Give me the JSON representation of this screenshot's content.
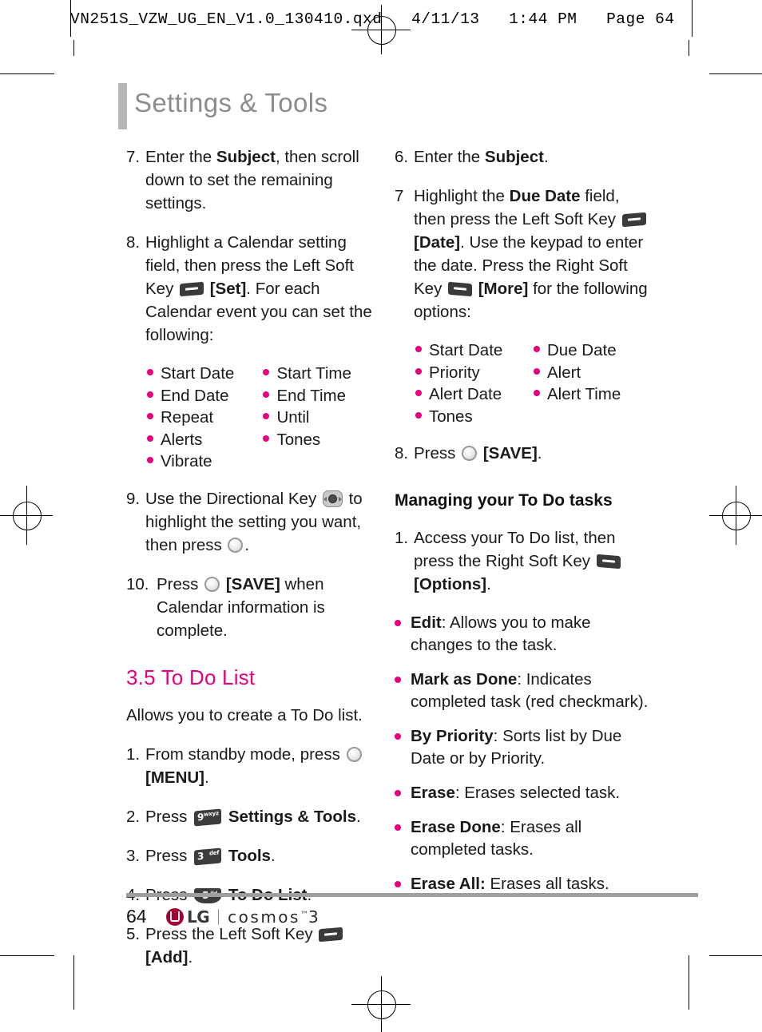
{
  "print_header": {
    "text": "VN251S_VZW_UG_EN_V1.0_130410.qxd   4/11/13   1:44 PM   Page 64"
  },
  "page_title": "Settings & Tools",
  "colors": {
    "accent_magenta": "#e6007e",
    "title_gray": "#8d8d8d",
    "rule_gray": "#9e9e9e",
    "lg_crimson": "#a50034"
  },
  "left_column": {
    "step7": {
      "num": "7.",
      "body_a": "Enter the ",
      "bold_a": "Subject",
      "body_b": ", then scroll down to set the remaining settings."
    },
    "step8": {
      "num": "8.",
      "body_a": "Highlight a Calendar setting field, then press the Left Soft Key ",
      "bold_a": "[Set]",
      "body_b": ". For each Calendar event you can set the following:"
    },
    "calendar_options": {
      "col1": [
        "Start Date",
        "End Date",
        "Repeat",
        "Alerts",
        "Vibrate"
      ],
      "col2": [
        "Start Time",
        "End Time",
        "Until",
        "Tones"
      ]
    },
    "step9": {
      "num": "9.",
      "body_a": "Use the Directional Key ",
      "body_b": " to highlight the setting you want, then press ",
      "body_c": "."
    },
    "step10": {
      "num": "10.",
      "body_a": "Press ",
      "bold_a": "[SAVE]",
      "body_b": " when Calendar information is complete."
    },
    "section_heading": "3.5 To Do List",
    "intro": "Allows you to create a To Do list.",
    "step1": {
      "num": "1.",
      "body_a": "From standby mode, press ",
      "bold_a": "[MENU]",
      "body_b": "."
    },
    "step2": {
      "num": "2.",
      "body_a": "Press ",
      "key": {
        "digit": "9",
        "letters": "wxyz"
      },
      "bold_a": "Settings & Tools",
      "body_b": "."
    },
    "step3": {
      "num": "3.",
      "body_a": "Press ",
      "key": {
        "digit": "3",
        "letters": "def"
      },
      "bold_a": "Tools",
      "body_b": "."
    },
    "step4": {
      "num": "4.",
      "body_a": "Press ",
      "key": {
        "digit": "5",
        "letters": "jkl"
      },
      "bold_a": "To Do List",
      "body_b": "."
    },
    "step5": {
      "num": "5.",
      "body_a": "Press the Left Soft Key ",
      "bold_a": "[Add]",
      "body_b": "."
    }
  },
  "right_column": {
    "step6": {
      "num": "6.",
      "body_a": "Enter the ",
      "bold_a": "Subject",
      "body_b": "."
    },
    "step7": {
      "num": "7",
      "body_a": "Highlight the ",
      "bold_a": "Due Date",
      "body_b": " field, then press the Left Soft Key ",
      "bold_b": "[Date]",
      "body_c": ". Use the keypad to enter the date. Press the Right Soft Key ",
      "bold_c": "[More]",
      "body_d": " for the following options:"
    },
    "todo_options": {
      "col1": [
        "Start Date",
        "Priority",
        "Alert Date",
        "Tones"
      ],
      "col2": [
        "Due Date",
        "Alert",
        "Alert Time"
      ]
    },
    "step8": {
      "num": "8.",
      "body_a": "Press ",
      "bold_a": "[SAVE]",
      "body_b": "."
    },
    "sub_heading": "Managing your To Do tasks",
    "step1": {
      "num": "1.",
      "body_a": "Access your To Do list, then press the Right Soft Key ",
      "bold_a": "[Options]",
      "body_b": "."
    },
    "options": [
      {
        "term": "Edit",
        "desc": ": Allows you to make changes to the task."
      },
      {
        "term": "Mark as Done",
        "desc": ": Indicates completed task (red checkmark)."
      },
      {
        "term": "By Priority",
        "desc": ": Sorts list by Due Date or by Priority."
      },
      {
        "term": "Erase",
        "desc": ": Erases selected task."
      },
      {
        "term": "Erase Done",
        "desc": ": Erases all completed tasks."
      },
      {
        "term": "Erase All:",
        "desc": " Erases all tasks."
      }
    ]
  },
  "footer": {
    "page_number": "64",
    "brand": "LG",
    "product": "cosmos",
    "product_tm": "™",
    "product_num": "3"
  }
}
